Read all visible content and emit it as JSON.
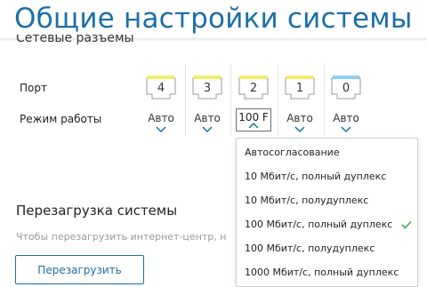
{
  "page": {
    "title": "Общие настройки системы"
  },
  "network_ports": {
    "section_title": "Сетевые разъемы",
    "port_label": "Порт",
    "mode_label": "Режим работы",
    "ports": [
      {
        "number": "4",
        "mode": "Авто",
        "indicator_color": "#f4ea6b"
      },
      {
        "number": "3",
        "mode": "Авто",
        "indicator_color": "#f4ea6b"
      },
      {
        "number": "2",
        "mode": "100 F",
        "indicator_color": "#f4ea6b"
      },
      {
        "number": "1",
        "mode": "Авто",
        "indicator_color": "#f4ea6b"
      },
      {
        "number": "0",
        "mode": "Авто",
        "indicator_color": "#8fd0ee"
      }
    ]
  },
  "mode_dropdown": {
    "options": [
      "Автосогласование",
      "10 Мбит/с, полный дуплекс",
      "10 Мбит/с, полудуплекс",
      "100 Мбит/с, полный дуплекс",
      "100 Мбит/с, полудуплекс",
      "1000 Мбит/с, полный дуплекс"
    ],
    "selected_option": "100 Мбит/с, полный дуплекс"
  },
  "reboot": {
    "title": "Перезагрузка системы",
    "hint": "Чтобы перезагрузить интернет-центр, н",
    "button_label": "Перезагрузить"
  },
  "colors": {
    "accent": "#1d6fa5",
    "check": "#3aaa5c",
    "port_indicator_lan": "#f4ea6b",
    "port_indicator_wan": "#8fd0ee"
  }
}
